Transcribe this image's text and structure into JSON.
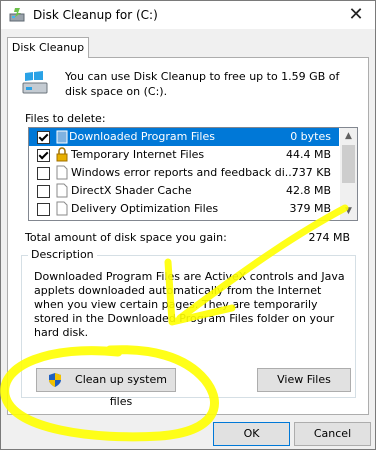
{
  "window": {
    "title": "Disk Cleanup for  (C:)",
    "close_glyph": "✕"
  },
  "tabs": [
    {
      "label": "Disk Cleanup"
    }
  ],
  "intro_text": "You can use Disk Cleanup to free up to 1.59 GB of disk space on  (C:).",
  "files_to_delete": {
    "label": "Files to delete:",
    "items": [
      {
        "name": "Downloaded Program Files",
        "size": "0 bytes",
        "checked": true,
        "selected": true,
        "icon": "folder-icon"
      },
      {
        "name": "Temporary Internet Files",
        "size": "44.4 MB",
        "checked": true,
        "selected": false,
        "icon": "lock-icon"
      },
      {
        "name": "Windows error reports and feedback di...",
        "size": "737 KB",
        "checked": false,
        "selected": false,
        "icon": "file-icon"
      },
      {
        "name": "DirectX Shader Cache",
        "size": "42.8 MB",
        "checked": false,
        "selected": false,
        "icon": "file-icon"
      },
      {
        "name": "Delivery Optimization Files",
        "size": "379 MB",
        "checked": false,
        "selected": false,
        "icon": "file-icon"
      }
    ]
  },
  "total": {
    "label": "Total amount of disk space you gain:",
    "value": "274 MB"
  },
  "description": {
    "legend": "Description",
    "text": "Downloaded Program Files are ActiveX controls and Java applets downloaded automatically from the Internet when you view certain pages. They are temporarily stored in the Downloaded Program Files folder on your hard disk."
  },
  "buttons": {
    "cleanup_system_files": "Clean up system files",
    "view_files": "View Files",
    "ok": "OK",
    "cancel": "Cancel"
  },
  "colors": {
    "selection": "#0078d7",
    "annotation_highlight": "#ffff00"
  }
}
